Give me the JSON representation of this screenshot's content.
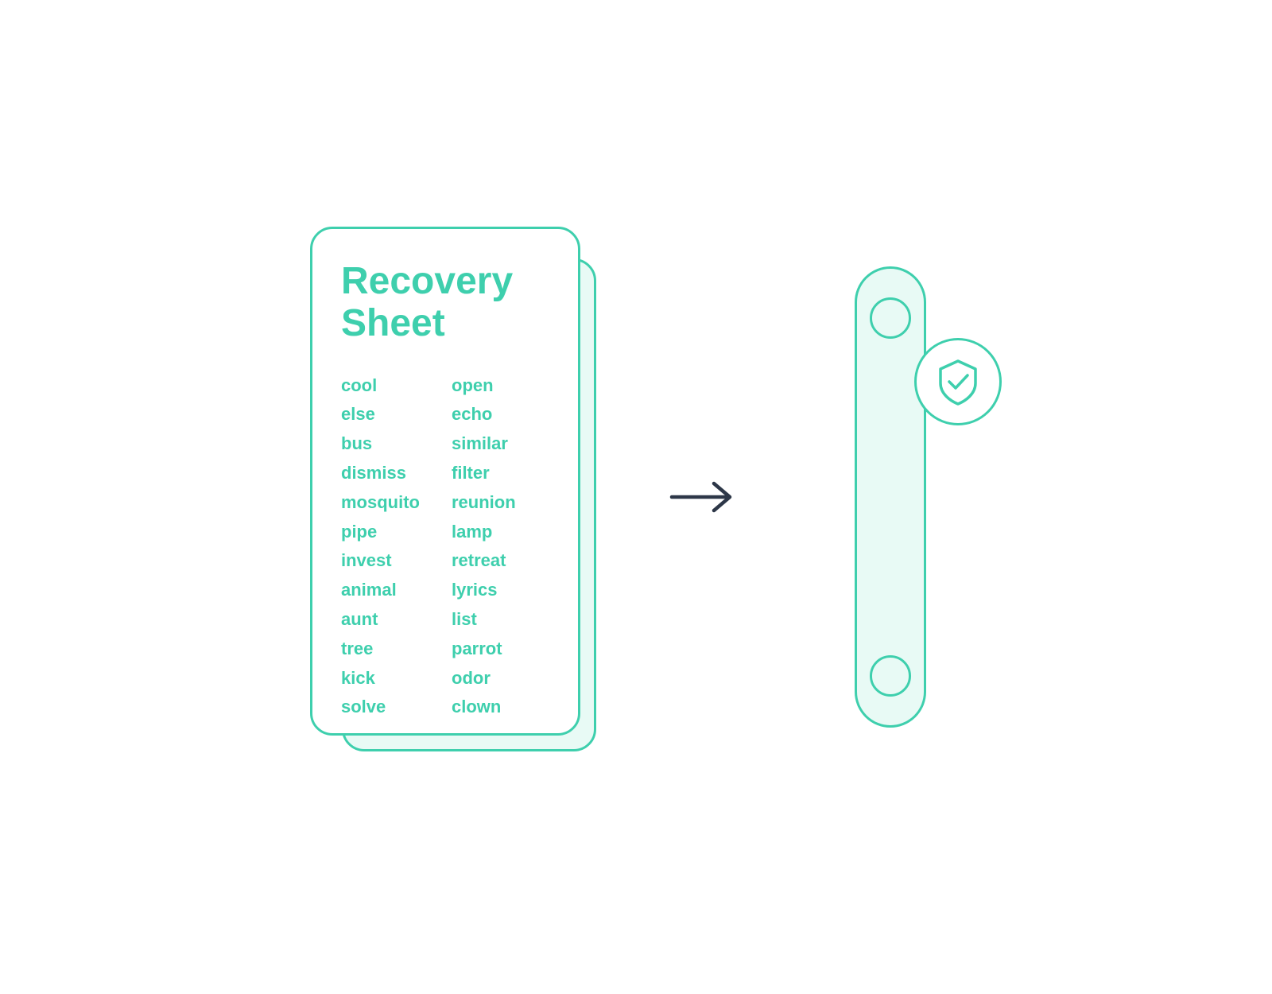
{
  "card": {
    "title_line1": "Recovery",
    "title_line2": "Sheet",
    "words_left": [
      "cool",
      "else",
      "bus",
      "dismiss",
      "mosquito",
      "pipe",
      "invest",
      "animal",
      "aunt",
      "tree",
      "kick",
      "solve"
    ],
    "words_right": [
      "open",
      "echo",
      "similar",
      "filter",
      "reunion",
      "lamp",
      "retreat",
      "lyrics",
      "list",
      "parrot",
      "odor",
      "clown"
    ]
  },
  "arrow": {
    "label": "→"
  },
  "device": {
    "circle_top_label": "circle-top",
    "circle_bottom_label": "circle-bottom"
  },
  "shield": {
    "label": "security shield checkmark"
  },
  "colors": {
    "teal": "#3ecfad",
    "light_teal_bg": "#e8faf5",
    "dark_arrow": "#2d3748"
  }
}
